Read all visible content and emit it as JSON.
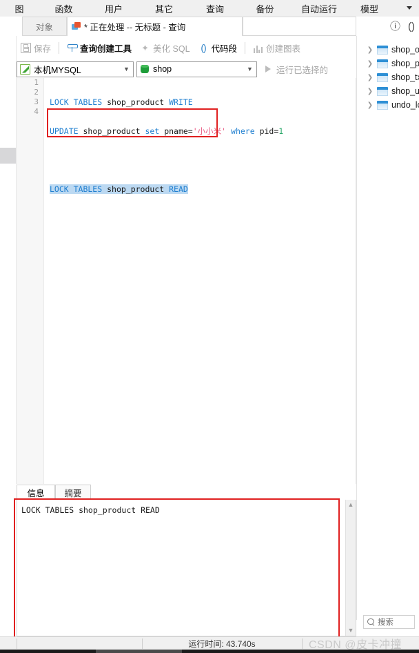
{
  "app": {
    "menu_items": [
      "图",
      "函数",
      "用户",
      "其它",
      "查询",
      "备份",
      "自动运行",
      "模型"
    ],
    "menu_overflow_icon": "chevron-down-icon"
  },
  "tabs": {
    "object_tab": "对象",
    "query_tab": "* 正在处理 -- 无标题 - 查询",
    "info_icon": "info-icon",
    "code_icon": "parentheses-icon"
  },
  "toolbar": {
    "save": "保存",
    "query_builder": "查询创建工具",
    "beautify_sql": "美化 SQL",
    "code_snippet": "代码段",
    "create_chart": "创建图表",
    "connection_value": "本机MYSQL",
    "database_value": "shop",
    "run_selected": "运行已选择的",
    "overflow_icon": "chevron-double-right-icon"
  },
  "editor": {
    "line_numbers": [
      "1",
      "2",
      "3",
      "4"
    ],
    "lines": [
      "LOCK TABLES shop_product WRITE",
      "UPDATE shop_product set pname='小小米' where pid=1",
      "",
      "LOCK TABLES shop_product READ"
    ],
    "highlight_line": "LOCK TABLES shop_product READ"
  },
  "results": {
    "tabs": [
      "信息",
      "摘要"
    ],
    "selected_tab": "信息",
    "output": "LOCK TABLES shop_product READ",
    "scroll_up_icon": "chevron-up-icon",
    "scroll_down_icon": "chevron-down-icon"
  },
  "statusbar": {
    "run_time": "运行时间: 43.740s"
  },
  "watermark": "CSDN @皮卡冲撞",
  "sidebar": {
    "items": [
      {
        "label": "shop_or",
        "icon": "table-icon"
      },
      {
        "label": "shop_pr",
        "icon": "table-icon"
      },
      {
        "label": "shop_tx",
        "icon": "table-icon"
      },
      {
        "label": "shop_us",
        "icon": "table-icon"
      },
      {
        "label": "undo_lo",
        "icon": "table-icon"
      }
    ],
    "search_placeholder": "搜索"
  },
  "colors": {
    "accent_blue": "#1f7fd0",
    "string_pink": "#e8557f",
    "number_green": "#2aa86a",
    "annotation_red": "#e02020",
    "selection_blue": "#bcd9f2"
  }
}
